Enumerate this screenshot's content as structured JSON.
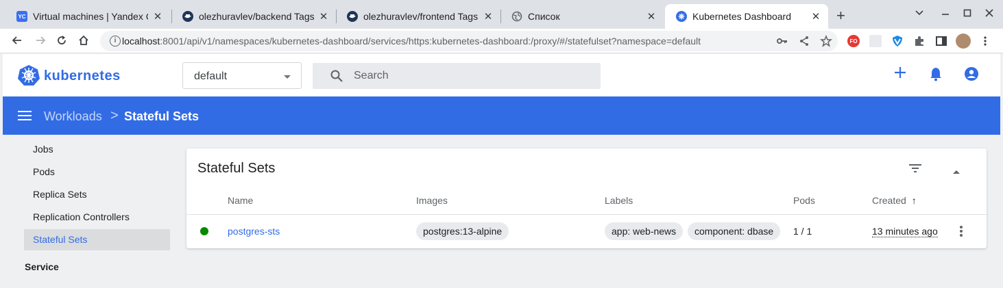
{
  "browser": {
    "tabs": [
      {
        "title": "Virtual machines | Yandex Co",
        "favicon": "YC",
        "favicon_color": "#3b6ff2",
        "active": false
      },
      {
        "title": "olezhuravlev/backend Tags |",
        "favicon": "docker",
        "favicon_color": "#1f3557",
        "active": false
      },
      {
        "title": "olezhuravlev/frontend Tags |",
        "favicon": "docker",
        "favicon_color": "#1f3557",
        "active": false
      },
      {
        "title": "Список",
        "favicon": "globe",
        "favicon_color": "#5f6368",
        "active": false
      },
      {
        "title": "Kubernetes Dashboard",
        "favicon": "kubernetes",
        "favicon_color": "#326ce5",
        "active": true
      }
    ],
    "url_host": "localhost",
    "url_rest": ":8001/api/v1/namespaces/kubernetes-dashboard/services/https:kubernetes-dashboard:/proxy/#/statefulset?namespace=default",
    "ext_badge": "FO"
  },
  "app": {
    "logo_text": "kubernetes",
    "namespace": "default",
    "search_placeholder": "Search"
  },
  "breadcrumb": {
    "parent": "Workloads",
    "separator": ">",
    "current": "Stateful Sets"
  },
  "sidebar": {
    "items": [
      {
        "label": "Jobs"
      },
      {
        "label": "Pods"
      },
      {
        "label": "Replica Sets"
      },
      {
        "label": "Replication Controllers"
      },
      {
        "label": "Stateful Sets",
        "active": true
      }
    ],
    "section": "Service"
  },
  "card": {
    "title": "Stateful Sets",
    "columns": {
      "name": "Name",
      "images": "Images",
      "labels": "Labels",
      "pods": "Pods",
      "created": "Created"
    },
    "sort_indicator": "↑",
    "rows": [
      {
        "status": "running",
        "status_color": "#098a00",
        "name": "postgres-sts",
        "image": "postgres:13-alpine",
        "label1": "app: web-news",
        "label2": "component: dbase",
        "pods": "1 / 1",
        "created": "13 minutes ago"
      }
    ]
  },
  "colors": {
    "accent": "#326ce5",
    "background": "#eef0f2"
  }
}
